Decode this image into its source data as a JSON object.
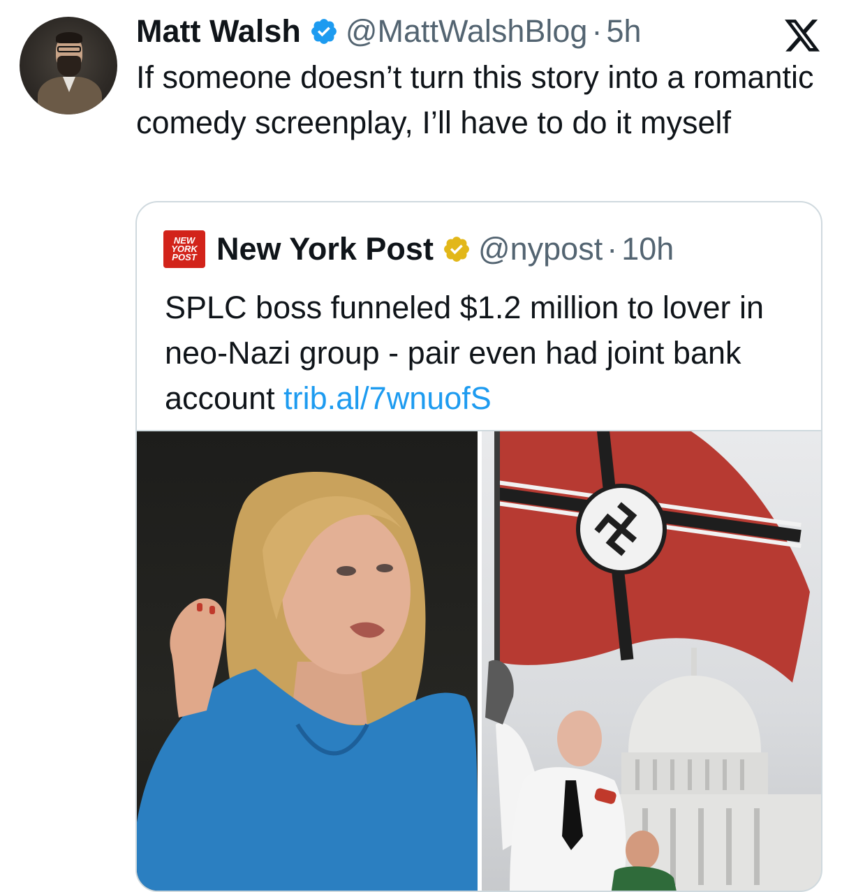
{
  "tweet": {
    "author_name": "Matt Walsh",
    "author_handle": "@MattWalshBlog",
    "separator": "·",
    "time": "5h",
    "text": "If someone doesn’t turn this story into a romantic comedy screenplay, I’ll have to do it myself"
  },
  "quoted_tweet": {
    "logo_lines": [
      "NEW",
      "YORK",
      "POST"
    ],
    "author_name": "New York Post",
    "author_handle": "@nypost",
    "separator": "·",
    "time": "10h",
    "text": "SPLC boss funneled $1.2 million to lover in neo-Nazi group - pair even had joint bank account",
    "link": "trib.al/7wnuofS"
  },
  "icons": {
    "verified": "verified-badge-icon",
    "verified_org": "gold-verified-badge-icon",
    "platform": "x-logo-icon"
  },
  "colors": {
    "text_primary": "#0f1419",
    "text_secondary": "#536471",
    "link": "#1d9bf0",
    "verified_blue": "#1d9bf0",
    "verified_gold": "#e2b719",
    "nyp_red": "#d2231a",
    "border": "#cfd9de"
  }
}
